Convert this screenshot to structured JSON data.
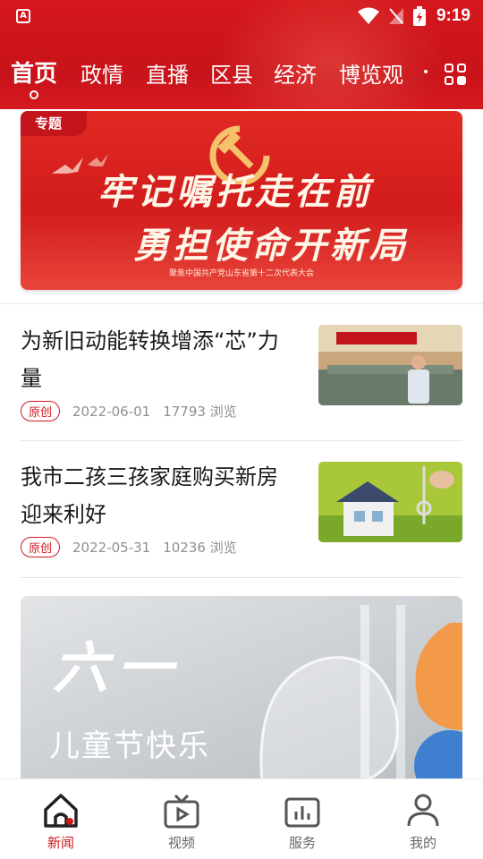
{
  "status_bar": {
    "time": "9:19",
    "app_icon": "app-notification-icon"
  },
  "tabs": [
    {
      "label": "首页",
      "active": true
    },
    {
      "label": "政情"
    },
    {
      "label": "直播"
    },
    {
      "label": "区县"
    },
    {
      "label": "经济"
    },
    {
      "label": "博览观"
    }
  ],
  "banner": {
    "tag": "专题",
    "line1": "牢记嘱托走在前",
    "line2": "勇担使命开新局",
    "subtitle": "聚焦中国共产党山东省第十二次代表大会"
  },
  "news": [
    {
      "title": "为新旧动能转换增添“芯”力量",
      "badge": "原创",
      "date": "2022-06-01",
      "views": "17793 浏览"
    },
    {
      "title": "我市二孩三孩家庭购买新房迎来利好",
      "badge": "原创",
      "date": "2022-05-31",
      "views": "10236 浏览"
    }
  ],
  "feature_card": {
    "title": "六一",
    "subtitle": "儿童节快乐"
  },
  "bottom_nav": [
    {
      "label": "新闻",
      "active": true
    },
    {
      "label": "视频"
    },
    {
      "label": "服务"
    },
    {
      "label": "我的"
    }
  ],
  "colors": {
    "brand": "#d4171c",
    "badge": "#d4171c",
    "muted": "#8f8f8f"
  }
}
